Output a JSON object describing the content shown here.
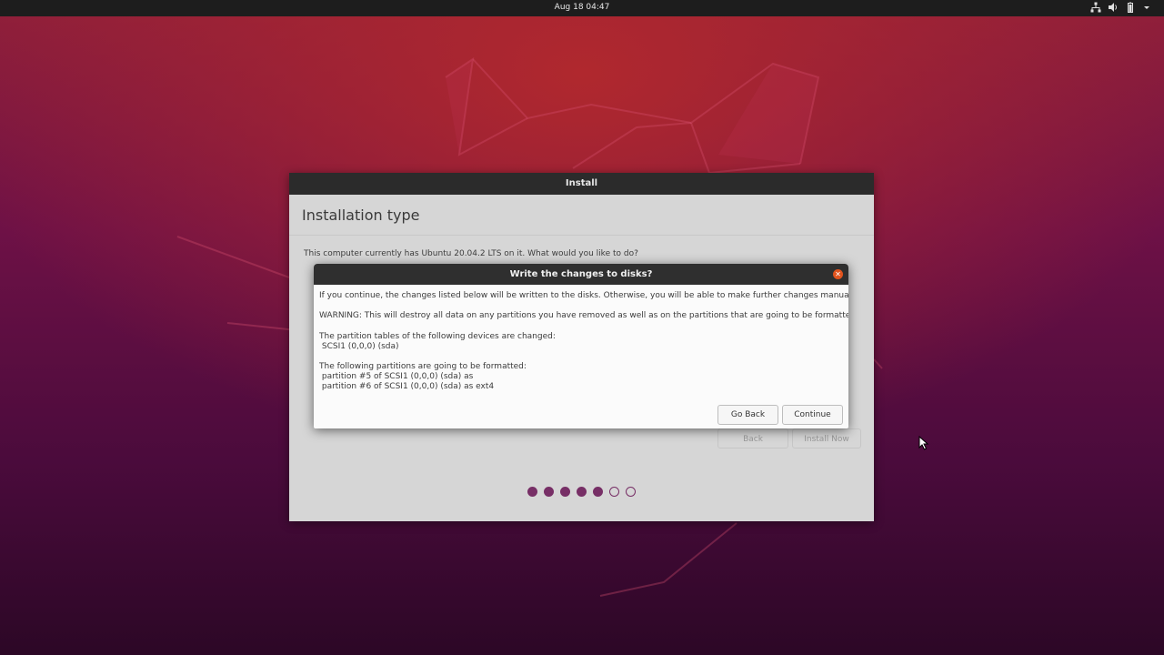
{
  "topbar": {
    "clock": "Aug 18  04:47",
    "icons": [
      "network-icon",
      "volume-icon",
      "battery-icon",
      "chevron-down-icon"
    ]
  },
  "window": {
    "title": "Install",
    "page_title": "Installation type",
    "question": "This computer currently has Ubuntu 20.04.2 LTS on it. What would you like to do?",
    "buttons": {
      "back": "Back",
      "install_now": "Install Now"
    },
    "progress": {
      "total_steps": 7,
      "completed_steps": 5
    }
  },
  "dialog": {
    "title": "Write the changes to disks?",
    "intro": "If you continue, the changes listed below will be written to the disks. Otherwise, you will be able to make further changes manually.",
    "warning": "WARNING: This will destroy all data on any partitions you have removed as well as on the partitions that are going to be formatted.",
    "partition_tables_heading": "The partition tables of the following devices are changed:",
    "partition_tables_device": " SCSI1 (0,0,0) (sda)",
    "formatted_heading": "The following partitions are going to be formatted:",
    "formatted_line_1": " partition #5 of SCSI1 (0,0,0) (sda) as",
    "formatted_line_2": " partition #6 of SCSI1 (0,0,0) (sda) as ext4",
    "buttons": {
      "go_back": "Go Back",
      "continue": "Continue"
    }
  },
  "colors": {
    "accent": "#772f66",
    "close_button": "#e2531d",
    "topbar": "#1d1d1d"
  }
}
